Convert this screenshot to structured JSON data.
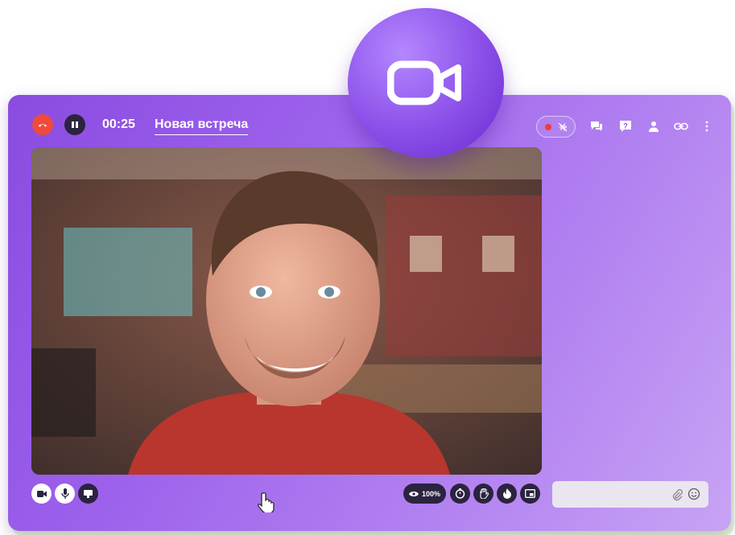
{
  "call": {
    "timer": "00:25",
    "meeting_title": "Новая встреча"
  },
  "bottom_bar": {
    "view_percent": "100%"
  },
  "chat": {
    "input_value": ""
  },
  "colors": {
    "accent": "#8a4be0",
    "hangup": "#ef4a3b",
    "dark_button": "#2b2340",
    "record_dot": "#ef3b3b"
  },
  "icons": {
    "header_left": [
      "hangup-icon",
      "pause-icon"
    ],
    "header_right": [
      "record-icon",
      "mute-noise-icon",
      "chat-icon",
      "help-icon",
      "participants-icon",
      "link-icon",
      "more-icon"
    ],
    "bottom_left": [
      "camera-icon",
      "microphone-icon",
      "screen-share-icon"
    ],
    "bottom_right": [
      "eye-icon",
      "timer-icon",
      "raise-hand-icon",
      "fire-icon",
      "picture-in-picture-icon"
    ],
    "chat_input": [
      "attach-icon",
      "emoji-icon"
    ],
    "badge": "video-camera-icon"
  }
}
